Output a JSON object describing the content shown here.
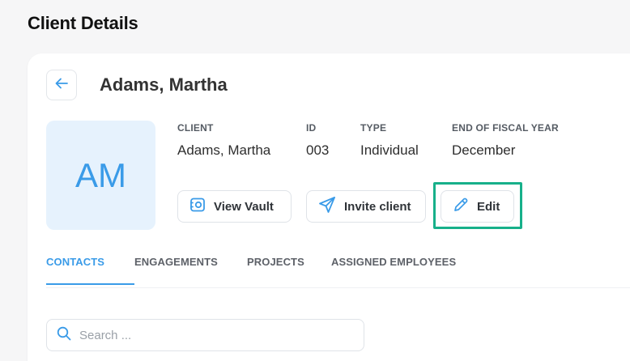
{
  "page": {
    "title": "Client Details"
  },
  "client": {
    "name": "Adams, Martha",
    "initials": "AM"
  },
  "info": [
    {
      "label": "CLIENT",
      "value": "Adams, Martha"
    },
    {
      "label": "ID",
      "value": "003"
    },
    {
      "label": "TYPE",
      "value": "Individual"
    },
    {
      "label": "END OF FISCAL YEAR",
      "value": "December"
    }
  ],
  "actions": {
    "view_vault": {
      "label": "View Vault",
      "icon": "vault-icon"
    },
    "invite_client": {
      "label": "Invite client",
      "icon": "paper-plane-icon"
    },
    "edit": {
      "label": "Edit",
      "icon": "pencil-icon"
    }
  },
  "tabs": [
    {
      "label": "CONTACTS",
      "active": true
    },
    {
      "label": "ENGAGEMENTS",
      "active": false
    },
    {
      "label": "PROJECTS",
      "active": false
    },
    {
      "label": "ASSIGNED EMPLOYEES",
      "active": false
    }
  ],
  "search": {
    "placeholder": "Search ..."
  },
  "colors": {
    "accent": "#3a9be8",
    "highlight": "#17b08a",
    "avatar_bg": "#e6f2fd"
  }
}
